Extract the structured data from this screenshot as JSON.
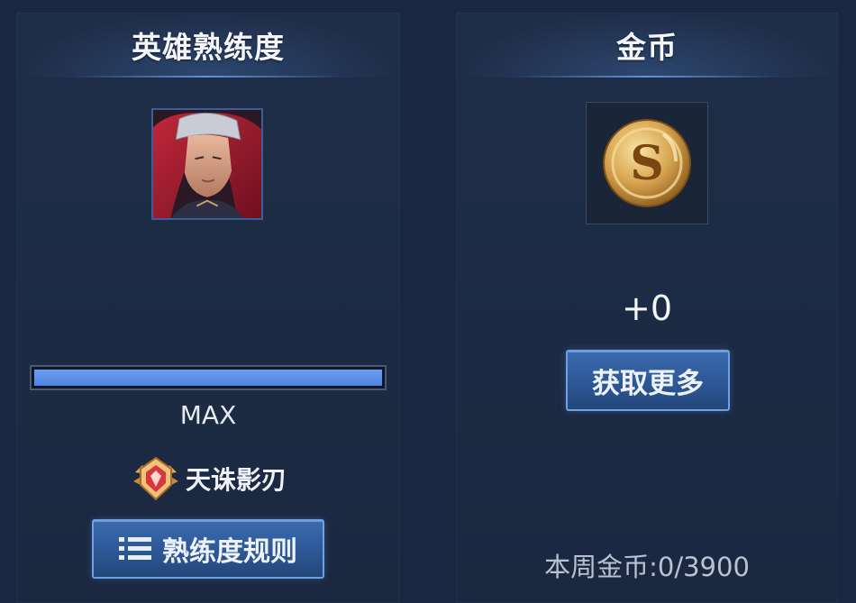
{
  "hero_panel": {
    "title": "英雄熟练度",
    "portrait_icon": "hero-portrait",
    "progress_fraction": 1.0,
    "progress_label": "MAX",
    "rank_icon": "rank-emblem-icon",
    "rank_label": "天诛影刃",
    "rules_button": {
      "icon": "list-icon",
      "label": "熟练度规则"
    }
  },
  "coin_panel": {
    "title": "金币",
    "coin_icon": "gold-coin-icon",
    "gain": "+0",
    "more_button": "获取更多",
    "weekly": "本周金币:0/3900"
  },
  "colors": {
    "background": "#1a2740",
    "panel": "#1f2e48",
    "progress_fill": "#5b8fe8",
    "button": "#2d5795",
    "button_border": "#6fa0df"
  }
}
